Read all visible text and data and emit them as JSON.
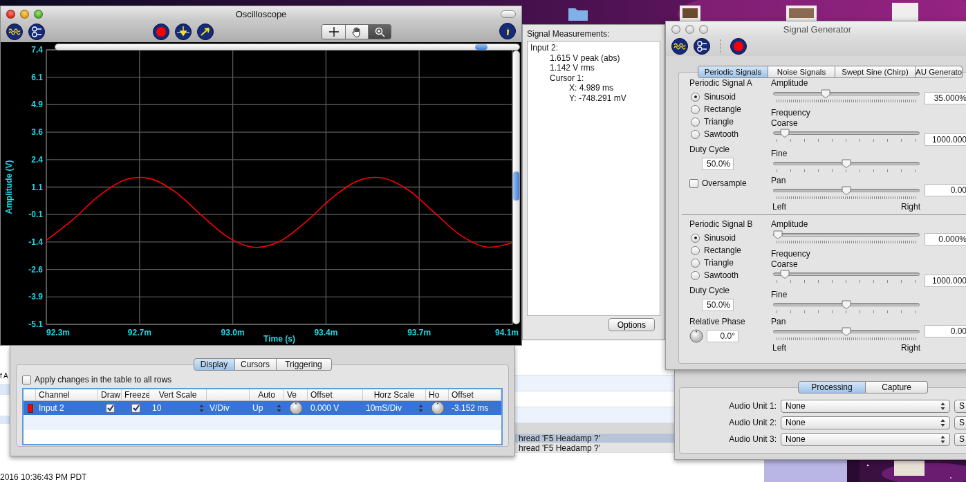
{
  "background_window": {
    "edge_text": "f A",
    "rows": [
      {
        "text": "hread 'F5 Headamp ?'",
        "selected": true
      },
      {
        "text": "hread 'F5 Headamp ?'",
        "selected": false
      }
    ],
    "timestamp": "2016 10:36:43 PM PDT"
  },
  "oscilloscope": {
    "title": "Oscilloscope",
    "tools": [
      {
        "kind": "crosshair",
        "selected": false
      },
      {
        "kind": "hand",
        "selected": false
      },
      {
        "kind": "zoom",
        "selected": true
      }
    ],
    "chart_data": {
      "type": "line",
      "xlabel": "Time (s)",
      "ylabel": "Amplitude (V)",
      "x": [
        92.3,
        92.4,
        92.5,
        92.6,
        92.7,
        92.8,
        92.9,
        93.0,
        93.1,
        93.2,
        93.3,
        93.4,
        93.5,
        93.6,
        93.7,
        93.8,
        93.9,
        94.0,
        94.1
      ],
      "grid": true,
      "series": [
        {
          "color": "#ff0000",
          "values": [
            -1.27,
            -0.36,
            0.72,
            1.46,
            1.54,
            0.91,
            -0.14,
            -1.12,
            -1.59,
            -1.33,
            -0.46,
            0.62,
            1.42,
            1.56,
            1.0,
            -0.03,
            -1.04,
            -1.58,
            -1.39
          ]
        }
      ],
      "xlim": [
        92.3,
        94.1
      ],
      "ylim": [
        -5.1,
        7.4
      ],
      "xticks": [
        {
          "value": 92.3,
          "label": "92.3m"
        },
        {
          "value": 92.66,
          "label": "92.7m"
        },
        {
          "value": 93.02,
          "label": "93.0m"
        },
        {
          "value": 93.38,
          "label": "93.4m"
        },
        {
          "value": 93.74,
          "label": "93.7m"
        },
        {
          "value": 94.1,
          "label": "94.1m"
        }
      ],
      "yticks": [
        {
          "value": 7.4,
          "label": "7.4"
        },
        {
          "value": 6.15,
          "label": "6.1"
        },
        {
          "value": 4.9,
          "label": "4.9"
        },
        {
          "value": 3.65,
          "label": "3.6"
        },
        {
          "value": 2.4,
          "label": "2.4"
        },
        {
          "value": 1.15,
          "label": "1.1"
        },
        {
          "value": -0.1,
          "label": "-0.1"
        },
        {
          "value": -1.35,
          "label": "-1.4"
        },
        {
          "value": -2.6,
          "label": "-2.6"
        },
        {
          "value": -3.85,
          "label": "-3.9"
        },
        {
          "value": -5.1,
          "label": "-5.1"
        }
      ]
    },
    "tabs": [
      {
        "label": "Display",
        "selected": true
      },
      {
        "label": "Cursors",
        "selected": false
      },
      {
        "label": "Triggering",
        "selected": false
      }
    ],
    "apply_all": {
      "label": "Apply changes in the table to all rows",
      "checked": false
    },
    "table": {
      "columns": [
        "Channel",
        "Draw",
        "Freeze",
        "Vert Scale",
        "Auto",
        "Ve",
        "Offset",
        "Horz Scale",
        "Ho",
        "Offset"
      ],
      "rows": [
        {
          "color": "#ff0000",
          "channel": "Input 2",
          "draw": true,
          "freeze": true,
          "vert_scale": "10",
          "vert_unit": "V/Div",
          "auto": "Up",
          "offset": "0.000 V",
          "horz_scale": "10mS/Div",
          "horz_offset": "-3.152 ms",
          "selected": true
        }
      ]
    }
  },
  "measurements": {
    "title": "Signal Measurements:",
    "lines": [
      {
        "text": "Input 2:",
        "children": [
          {
            "text": "1.615 V peak (abs)"
          },
          {
            "text": "1.142 V rms"
          },
          {
            "text": "Cursor 1:",
            "children": [
              {
                "text": "X: 4.989 ms"
              },
              {
                "text": "Y: -748.291 mV"
              }
            ]
          }
        ]
      }
    ],
    "button": "Options"
  },
  "signal_generator": {
    "title": "Signal Generator",
    "tabs": [
      {
        "label": "Periodic Signals",
        "selected": true
      },
      {
        "label": "Noise Signals",
        "selected": false
      },
      {
        "label": "Swept Sine (Chirp)",
        "selected": false
      },
      {
        "label": "AU Generato",
        "selected": false
      }
    ],
    "sections": [
      {
        "title": "Periodic Signal A",
        "waveforms": [
          {
            "label": "Sinusoid",
            "selected": true
          },
          {
            "label": "Rectangle",
            "selected": false
          },
          {
            "label": "Triangle",
            "selected": false
          },
          {
            "label": "Sawtooth",
            "selected": false
          }
        ],
        "duty_cycle": {
          "label": "Duty Cycle",
          "value": "50.0%"
        },
        "option": {
          "kind": "checkbox",
          "label": "Oversample",
          "checked": false
        },
        "amplitude": {
          "label": "Amplitude",
          "level": 0.35,
          "value": "35.000%"
        },
        "frequency": {
          "label": "Frequency",
          "coarse": {
            "label": "Coarse",
            "level": 0.05
          },
          "fine": {
            "label": "Fine",
            "level": 0.5
          },
          "value": "1000.000"
        },
        "pan": {
          "label": "Pan",
          "level": 0.5,
          "value": "0.00",
          "left": "Left",
          "right": "Right"
        }
      },
      {
        "title": "Periodic Signal B",
        "waveforms": [
          {
            "label": "Sinusoid",
            "selected": true
          },
          {
            "label": "Rectangle",
            "selected": false
          },
          {
            "label": "Triangle",
            "selected": false
          },
          {
            "label": "Sawtooth",
            "selected": false
          }
        ],
        "duty_cycle": {
          "label": "Duty Cycle",
          "value": "50.0%"
        },
        "option": {
          "kind": "phase",
          "label": "Relative Phase",
          "value": "0.0°"
        },
        "amplitude": {
          "label": "Amplitude",
          "level": 0,
          "value": "0.000%"
        },
        "frequency": {
          "label": "Frequency",
          "coarse": {
            "label": "Coarse",
            "level": 0.05
          },
          "fine": {
            "label": "Fine",
            "level": 0.5
          },
          "value": "1000.000"
        },
        "pan": {
          "label": "Pan",
          "level": 0.5,
          "value": "0.00",
          "left": "Left",
          "right": "Right"
        }
      }
    ]
  },
  "processing": {
    "tabs": [
      {
        "label": "Processing",
        "selected": true
      },
      {
        "label": "Capture",
        "selected": false
      }
    ],
    "audio_units": [
      {
        "label": "Audio Unit 1:",
        "value": "None",
        "button": "S"
      },
      {
        "label": "Audio Unit 2:",
        "value": "None",
        "button": "S"
      },
      {
        "label": "Audio Unit 3:",
        "value": "None",
        "button": "S"
      }
    ]
  }
}
